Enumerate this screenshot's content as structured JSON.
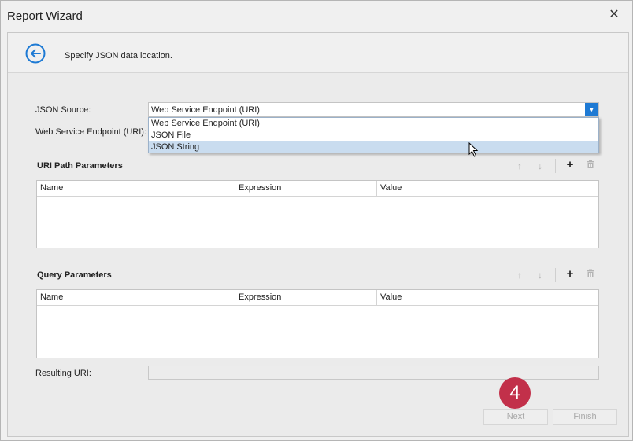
{
  "window": {
    "title": "Report Wizard",
    "close_glyph": "✕"
  },
  "header": {
    "instruction": "Specify JSON data location.",
    "back_icon": "back-arrow-circle-icon",
    "accent_color": "#1e7ad4"
  },
  "form": {
    "json_source_label": "JSON Source:",
    "json_source_value": "Web Service Endpoint (URI)",
    "endpoint_label": "Web Service Endpoint (URI):",
    "dropdown_options": [
      "Web Service Endpoint (URI)",
      "JSON File",
      "JSON String"
    ],
    "hovered_option": "JSON String",
    "resulting_uri_label": "Resulting URI:",
    "resulting_uri_value": ""
  },
  "uri_path_params": {
    "title": "URI Path Parameters",
    "columns": [
      "Name",
      "Expression",
      "Value"
    ]
  },
  "query_params": {
    "title": "Query Parameters",
    "columns": [
      "Name",
      "Expression",
      "Value"
    ]
  },
  "toolbar": {
    "up": "↑",
    "down": "↓",
    "add": "+",
    "delete": "🗑"
  },
  "step_badge": "4",
  "buttons": {
    "next": "Next",
    "finish": "Finish"
  }
}
